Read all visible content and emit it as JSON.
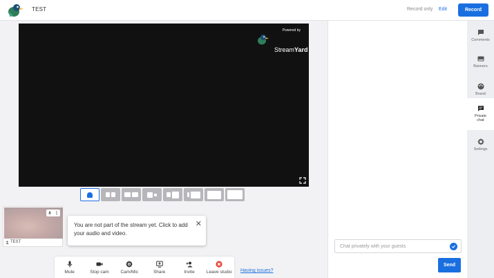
{
  "topbar": {
    "title": "TEST",
    "record_only": "Record only",
    "edit": "Edit",
    "record": "Record"
  },
  "stage": {
    "powered_by": "Powered by",
    "brand_stream": "Stream",
    "brand_yard": "Yard"
  },
  "camera": {
    "name": "TEST"
  },
  "tooltip": {
    "text": "You are not part of the stream yet. Click to add your audio and video."
  },
  "controls": {
    "mute": "Mute",
    "stop_cam": "Stop cam",
    "cam_mic": "Cam/Mic",
    "share": "Share",
    "invite": "Invite",
    "leave": "Leave studio",
    "having_issues": "Having issues?"
  },
  "chat": {
    "placeholder": "Chat privately with your guests",
    "send": "Send"
  },
  "rail": {
    "comments": "Comments",
    "banners": "Banners",
    "brand": "Brand",
    "private_chat_1": "Private",
    "private_chat_2": "chat",
    "settings": "Settings"
  },
  "colors": {
    "accent": "#1a6fe0",
    "leave": "#e5483a",
    "stage_bg": "#111111"
  }
}
